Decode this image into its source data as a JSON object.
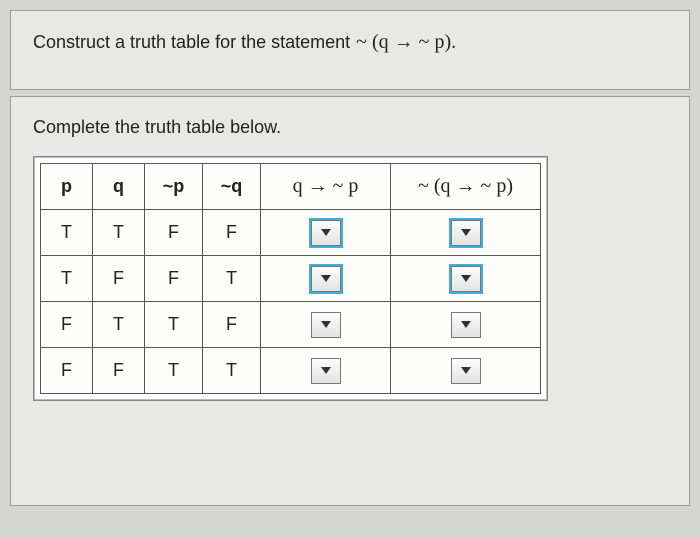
{
  "top": {
    "prefix": "Construct a truth table for the statement",
    "expression": "~ (q → ~ p)."
  },
  "bottom": {
    "instruction": "Complete the truth table below."
  },
  "table": {
    "headers": {
      "p": "p",
      "q": "q",
      "notp": "~p",
      "notq": "~q",
      "qimp_notp": "q → ~ p",
      "neg_qimp_notp": "~ (q → ~ p)"
    },
    "rows": [
      {
        "p": "T",
        "q": "T",
        "notp": "F",
        "notq": "F"
      },
      {
        "p": "T",
        "q": "F",
        "notp": "F",
        "notq": "T"
      },
      {
        "p": "F",
        "q": "T",
        "notp": "T",
        "notq": "F"
      },
      {
        "p": "F",
        "q": "F",
        "notp": "T",
        "notq": "T"
      }
    ]
  }
}
